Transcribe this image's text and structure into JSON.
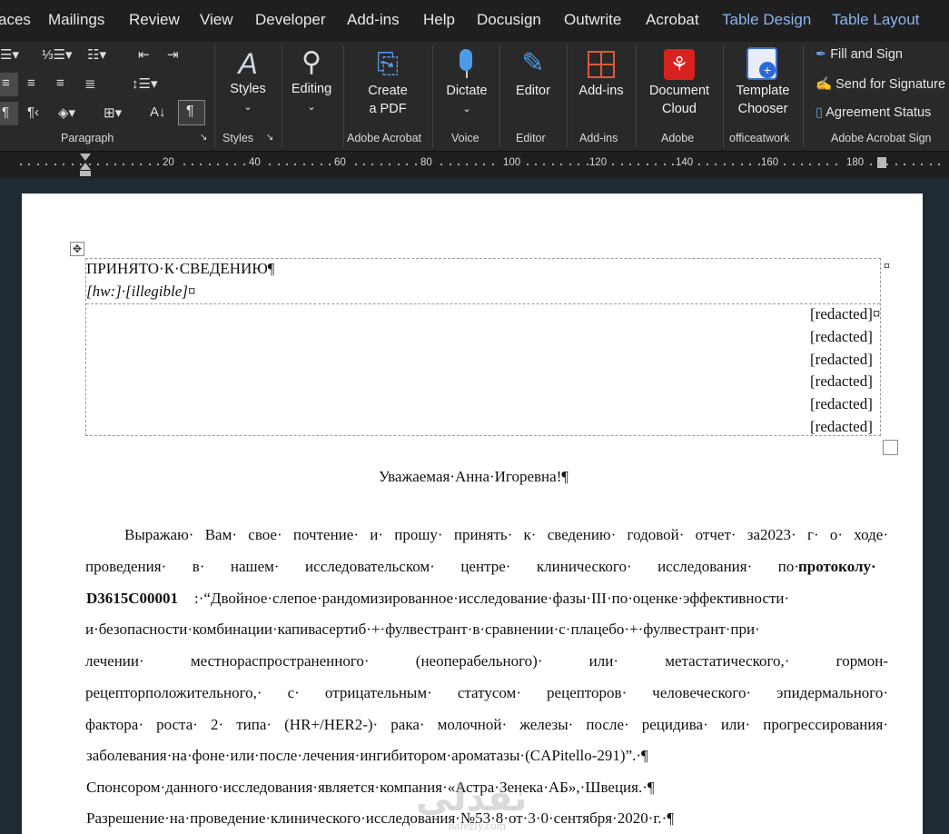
{
  "tabs": [
    "aces",
    "Mailings",
    "Review",
    "View",
    "Developer",
    "Add-ins",
    "Help",
    "Docusign",
    "Outwrite",
    "Acrobat",
    "Table Design",
    "Table Layout"
  ],
  "ribbon": {
    "groups": {
      "paragraph": "Paragraph",
      "styles": "Styles",
      "adobe_acrobat": "Adobe Acrobat",
      "voice": "Voice",
      "editor": "Editor",
      "addins": "Add-ins",
      "adobe": "Adobe",
      "officeatwork": "officeatwork",
      "adobe_sign": "Adobe Acrobat Sign"
    },
    "buttons": {
      "styles": "Styles",
      "editing": "Editing",
      "create_pdf_1": "Create",
      "create_pdf_2": "a PDF",
      "dictate": "Dictate",
      "editor": "Editor",
      "addins": "Add-ins",
      "doc_cloud_1": "Document",
      "doc_cloud_2": "Cloud",
      "template_1": "Template",
      "template_2": "Chooser",
      "fill_sign": "Fill and Sign",
      "send_sig": "Send for Signature",
      "agreement": "Agreement Status"
    }
  },
  "ruler": [
    "20",
    "40",
    "60",
    "80",
    "100",
    "120",
    "140",
    "160",
    "180"
  ],
  "document": {
    "header_title": "ПРИНЯТО·К·СВЕДЕНИЮ¶",
    "header_sig": "[hw:]·[illegible]¤",
    "cell_marker": "¤",
    "redacted": [
      "[redacted]¤",
      "[redacted]",
      "[redacted]",
      "[redacted]",
      "[redacted]",
      "[redacted]"
    ],
    "greeting": "Уважаемая·Анна·Игоревна!¶",
    "body_lines": [
      "Выражаю· Вам· свое· почтение· и· прошу· принять· к· сведению· годовой· отчет· за2023· г· о· ходе·",
      "проведения· в· нашем· исследовательском· центре· клинического· исследования· по·",
      "и·безопасности·комбинации·капивасертиб·+·фулвестрант·в·сравнении·с·плацебо·+·фулвестрант·при·",
      "лечении· местнораспространенного· (неоперабельного)· или· метастатического,· гормон-",
      "рецепторположительного,· с· отрицательным· статусом· рецепторов· человеческого· эпидермального·",
      "фактора· роста· 2· типа· (HR+/HER2-)· рака· молочной· железы· после· рецидива· или· прогрессирования·"
    ],
    "line2_bold": "протоколу·",
    "line3_bold": "D3615C00001",
    "line3_rest": ":·“Двойное·слепое·рандомизированное·исследование·фазы·III·по·оценке·эффективности·",
    "line8": "заболевания·на·фоне·или·после·лечения·ингибитором·ароматазы·(CAPitello-291)”.·¶",
    "line9": "Спонсором·данного·исследования·является·компания·«Астра·Зенека·АБ»,·Швеция.·¶",
    "line10": "Разрешение·на·проведение·клинического·исследования·№53·8·от·3·0·сентября·2020·г.·¶",
    "watermark": "نفذلي",
    "watermark_small": "nafezly.com"
  }
}
